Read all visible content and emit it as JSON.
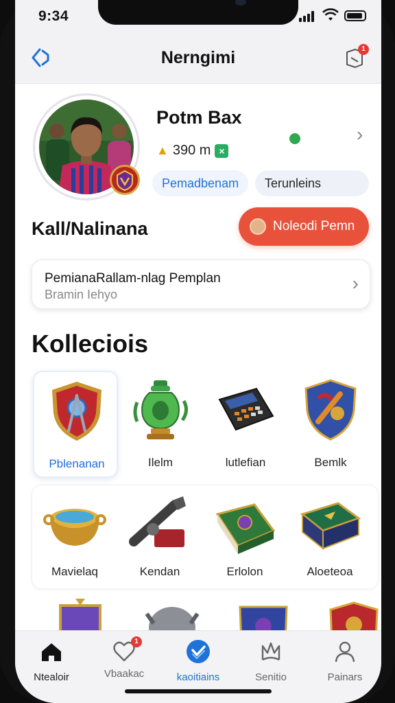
{
  "status_bar": {
    "time": "9:34"
  },
  "header": {
    "title": "Nerngimi",
    "notification_count": "1"
  },
  "profile": {
    "name": "Potm Bax",
    "stat": "390 m",
    "tag_primary": "Pemadbenam",
    "tag_secondary": "Terunleins"
  },
  "section": {
    "title": "Kall/Nalinana",
    "cta_label": "Noleodi Pemn"
  },
  "info_card": {
    "line1": "PemianaRallam-nlag Pemplan",
    "line2": "Bramin Iehyo"
  },
  "collection": {
    "title": "Kolleciois",
    "row1": [
      {
        "label": "Pblenanan",
        "icon": "shield-compass-icon"
      },
      {
        "label": "Ilelm",
        "icon": "potion-urn-icon"
      },
      {
        "label": "lutlefian",
        "icon": "calculator-icon"
      },
      {
        "label": "Bemlk",
        "icon": "emblem-shield-icon"
      }
    ],
    "row2": [
      {
        "label": "Mavielaq",
        "icon": "golden-bowl-icon"
      },
      {
        "label": "Kendan",
        "icon": "cannon-icon"
      },
      {
        "label": "Erlolon",
        "icon": "spellbook-icon"
      },
      {
        "label": "Aloeteoa",
        "icon": "treasure-chest-icon"
      }
    ]
  },
  "tabs": [
    {
      "label": "Ntealoir",
      "icon": "home-icon"
    },
    {
      "label": "Vbaakac",
      "icon": "heart-icon",
      "badge": "1"
    },
    {
      "label": "kaoitiains",
      "icon": "check-circle-icon"
    },
    {
      "label": "Senitio",
      "icon": "crown-icon"
    },
    {
      "label": "Painars",
      "icon": "person-icon"
    }
  ],
  "colors": {
    "accent": "#1e72d8",
    "cta": "#e8523b",
    "badge": "#e53935"
  }
}
